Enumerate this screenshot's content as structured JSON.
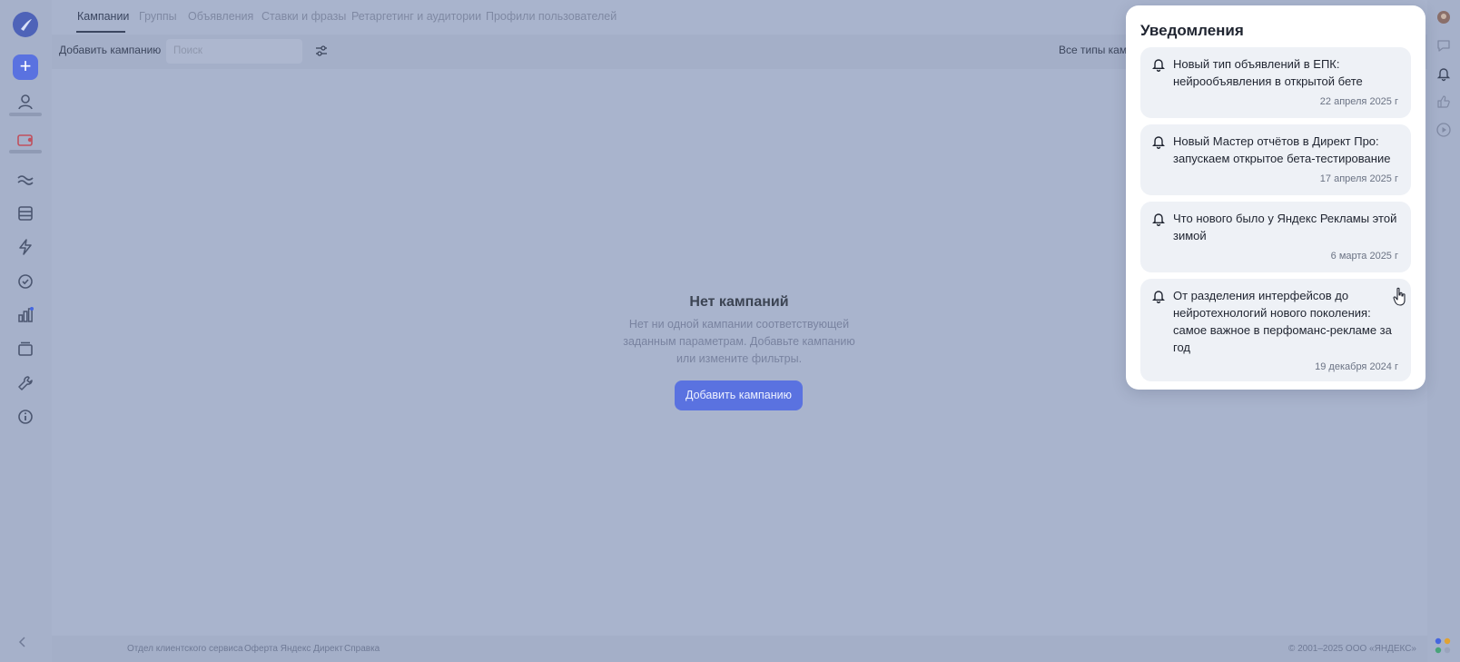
{
  "nav": {
    "tabs": [
      {
        "label": "Кампании",
        "active": true
      },
      {
        "label": "Группы"
      },
      {
        "label": "Объявления"
      },
      {
        "label": "Ставки и фразы"
      },
      {
        "label": "Ретаргетинг и аудитории"
      },
      {
        "label": "Профили пользователей"
      }
    ]
  },
  "toolbar": {
    "add_label": "Добавить кампанию",
    "search_placeholder": "Поиск",
    "types_label": "Все типы камп"
  },
  "empty_state": {
    "title": "Нет кампаний",
    "description": "Нет ни одной кампании соответствующей заданным параметрам. Добавьте кампанию или измените фильтры.",
    "button_label": "Добавить кампанию"
  },
  "footer": {
    "links": [
      "Отдел клиентского сервиса",
      "Оферта Яндекс Директ",
      "Справка"
    ],
    "copyright": "© 2001–2025 ООО «ЯНДЕКС»"
  },
  "notifications": {
    "heading": "Уведомления",
    "items": [
      {
        "text": "Новый тип объявлений в ЕПК: нейрообъявления в открытой бете",
        "date": "22 апреля 2025 г"
      },
      {
        "text": "Новый Мастер отчётов в Директ Про: запускаем открытое бета-тестирование",
        "date": "17 апреля 2025 г"
      },
      {
        "text": "Что нового было у Яндекс Рекламы этой зимой",
        "date": "6 марта 2025 г"
      },
      {
        "text": "От разделения интерфейсов до нейротехнологий нового поколения: самое важное в перфоманс-рекламе за год",
        "date": "19 декабря 2024 г"
      }
    ]
  },
  "colors": {
    "accent": "#5a72e0",
    "overlay_bg": "#a9b4cd",
    "panel_bg": "#ffffff",
    "card_bg": "#eef1f6"
  },
  "icons": {
    "sidebar": [
      "logo-icon",
      "plus-icon",
      "user-icon",
      "wallet-icon",
      "waves-icon",
      "database-icon",
      "lightning-icon",
      "check-circle-icon",
      "chart-icon",
      "layers-icon",
      "wrench-icon",
      "info-icon"
    ],
    "right_rail": [
      "avatar-icon",
      "chat-icon",
      "bell-icon",
      "thumb-up-icon",
      "play-icon"
    ]
  }
}
